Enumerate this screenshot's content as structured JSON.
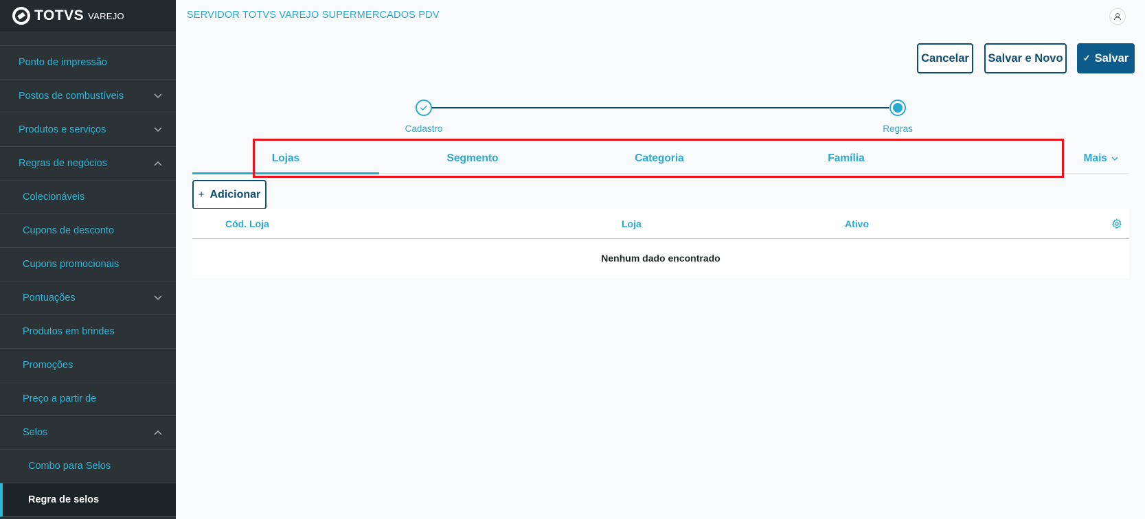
{
  "app": {
    "logo_text": "TOTVS",
    "logo_sub": "VAREJO",
    "header_title": "SERVIDOR TOTVS VAREJO SUPERMERCADOS PDV"
  },
  "sidebar": {
    "items": [
      {
        "label": "Ponto de impressão"
      },
      {
        "label": "Postos de combustíveis"
      },
      {
        "label": "Produtos e serviços"
      },
      {
        "label": "Regras de negócios"
      },
      {
        "label": "Colecionáveis"
      },
      {
        "label": "Cupons de desconto"
      },
      {
        "label": "Cupons promocionais"
      },
      {
        "label": "Pontuações"
      },
      {
        "label": "Produtos em brindes"
      },
      {
        "label": "Promoções"
      },
      {
        "label": "Preço a partir de"
      },
      {
        "label": "Selos"
      },
      {
        "label": "Combo para Selos"
      },
      {
        "label": "Regra de selos"
      }
    ]
  },
  "actions": {
    "cancel": "Cancelar",
    "save_new": "Salvar e Novo",
    "save": "Salvar"
  },
  "stepper": {
    "steps": [
      {
        "label": "Cadastro",
        "state": "done"
      },
      {
        "label": "Regras",
        "state": "current"
      }
    ]
  },
  "tabs": [
    {
      "label": "Lojas",
      "active": true
    },
    {
      "label": "Segmento"
    },
    {
      "label": "Categoria"
    },
    {
      "label": "Família"
    },
    {
      "label": "Mais"
    }
  ],
  "table": {
    "add_label": "Adicionar",
    "columns": [
      "Cód. Loja",
      "Loja",
      "Ativo"
    ],
    "empty_text": "Nenhum dado encontrado"
  },
  "colors": {
    "accent": "#29a9cf",
    "primary": "#0c5b8a",
    "sidebar_bg": "#2b3337",
    "highlight": "#e8141c"
  }
}
